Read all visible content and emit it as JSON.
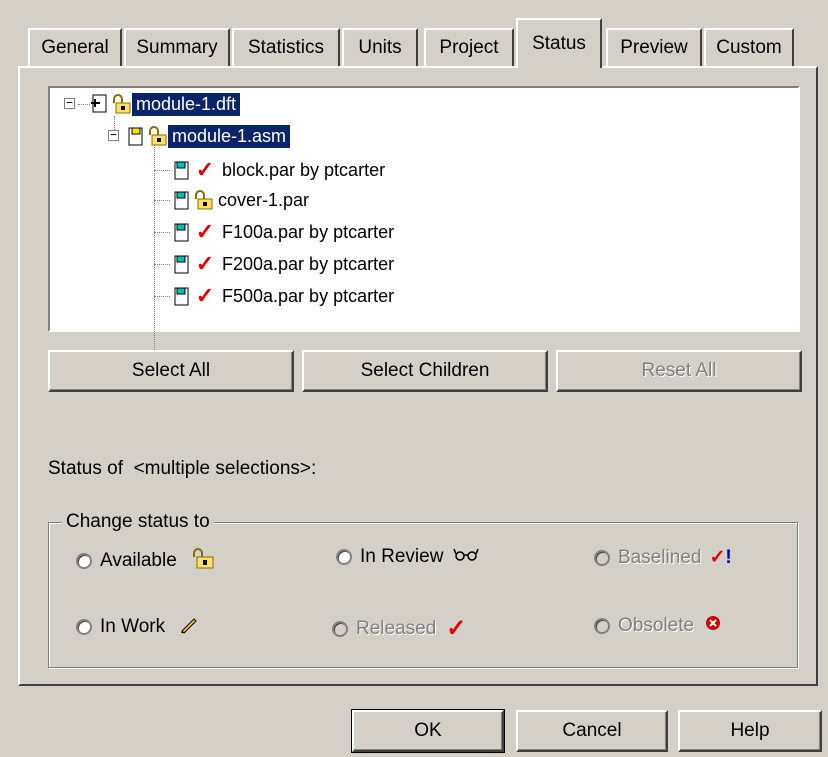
{
  "tabs": [
    {
      "label": "General",
      "active": false
    },
    {
      "label": "Summary",
      "active": false
    },
    {
      "label": "Statistics",
      "active": false
    },
    {
      "label": "Units",
      "active": false
    },
    {
      "label": "Project",
      "active": false
    },
    {
      "label": "Status",
      "active": true
    },
    {
      "label": "Preview",
      "active": false
    },
    {
      "label": "Custom",
      "active": false
    }
  ],
  "tree": {
    "root": {
      "label": "module-1.dft",
      "expanded": true,
      "selected": true,
      "icon": "draft-lock-icon"
    },
    "assembly": {
      "label": "module-1.asm",
      "expanded": true,
      "selected": true,
      "icon": "assembly-lock-icon"
    },
    "children": [
      {
        "label": "block.par by ptcarter",
        "status_icon": "check-icon"
      },
      {
        "label": "cover-1.par",
        "status_icon": "lock-icon"
      },
      {
        "label": "F100a.par by ptcarter",
        "status_icon": "check-icon"
      },
      {
        "label": "F200a.par by ptcarter",
        "status_icon": "check-icon"
      },
      {
        "label": "F500a.par by ptcarter",
        "status_icon": "check-icon"
      }
    ]
  },
  "buttons": {
    "select_all": "Select All",
    "select_children": "Select Children",
    "reset_all": "Reset All",
    "ok": "OK",
    "cancel": "Cancel",
    "help": "Help"
  },
  "status_of": {
    "prefix": "Status of",
    "value": "<multiple selections>:"
  },
  "change_status": {
    "legend": "Change status to",
    "options": [
      {
        "label": "Available",
        "enabled": true,
        "icon": "lock-icon"
      },
      {
        "label": "In Review",
        "enabled": true,
        "icon": "glasses-icon"
      },
      {
        "label": "Baselined",
        "enabled": false,
        "icon": "check-exclaim-icon"
      },
      {
        "label": "In Work",
        "enabled": true,
        "icon": "pencil-icon"
      },
      {
        "label": "Released",
        "enabled": false,
        "icon": "check-icon"
      },
      {
        "label": "Obsolete",
        "enabled": false,
        "icon": "obsolete-x-icon"
      }
    ]
  },
  "colors": {
    "selection": "#0a246a",
    "check": "#e00000",
    "face": "#d4d0c8"
  }
}
